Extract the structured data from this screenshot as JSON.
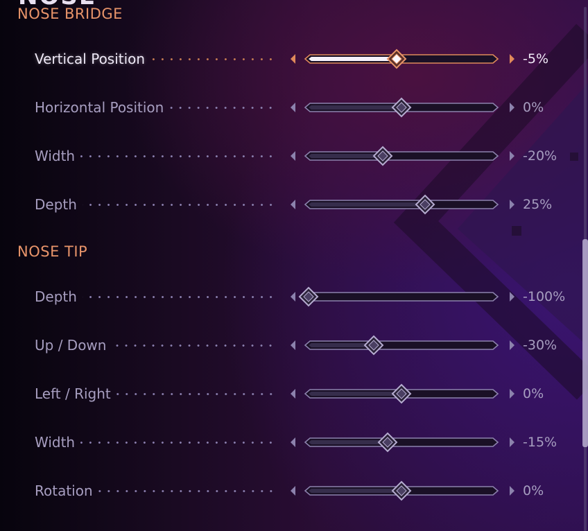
{
  "page": {
    "title": "NOSE",
    "accent_color": "#e8946a",
    "inactive_color": "#a79ec0"
  },
  "sections": [
    {
      "title": "NOSE BRIDGE",
      "rows": [
        {
          "label": "Vertical Position",
          "value": "-5%",
          "level": -5,
          "active": true
        },
        {
          "label": "Horizontal Position",
          "value": "0%",
          "level": 0,
          "active": false
        },
        {
          "label": "Width",
          "value": "-20%",
          "level": -20,
          "active": false
        },
        {
          "label": "Depth",
          "value": "25%",
          "level": 25,
          "active": false
        }
      ]
    },
    {
      "title": "NOSE TIP",
      "rows": [
        {
          "label": "Depth",
          "value": "-100%",
          "level": -100,
          "active": false
        },
        {
          "label": "Up / Down",
          "value": "-30%",
          "level": -30,
          "active": false
        },
        {
          "label": "Left / Right",
          "value": "0%",
          "level": 0,
          "active": false
        },
        {
          "label": "Width",
          "value": "-15%",
          "level": -15,
          "active": false
        },
        {
          "label": "Rotation",
          "value": "0%",
          "level": 0,
          "active": false
        }
      ]
    }
  ],
  "icons": {
    "left_arrow": "chevron-left-icon",
    "right_arrow": "chevron-right-icon",
    "slider_thumb": "diamond-icon"
  }
}
